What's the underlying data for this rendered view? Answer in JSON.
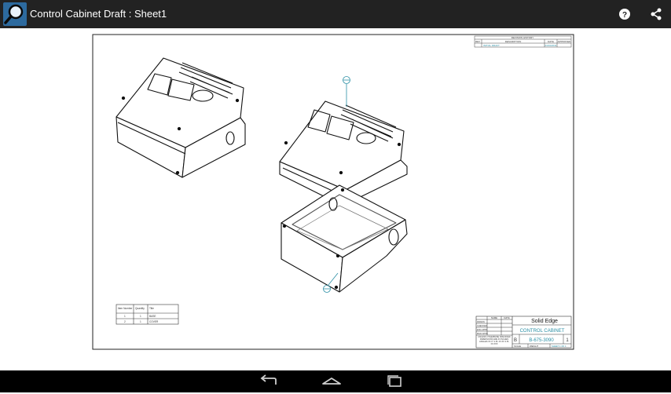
{
  "app": {
    "title": "Control Cabinet Draft : Sheet1"
  },
  "actions": {
    "help_icon": "help-circle-icon",
    "share_icon": "share-icon"
  },
  "drawing": {
    "revision_history": {
      "title": "REVISION HISTORY",
      "headers": [
        "REV",
        "DESCRIPTION",
        "DATE",
        "APPROVED"
      ],
      "rows": [
        [
          "",
          "INITIAL DRAFT",
          "01/01/2011",
          ""
        ]
      ]
    },
    "parts_list": {
      "headers": [
        "Item Number",
        "Quantity",
        "Title"
      ],
      "rows": [
        [
          "1",
          "1",
          "BASE"
        ],
        [
          "2",
          "1",
          "COVER"
        ]
      ]
    },
    "title_block": {
      "product": "Solid Edge",
      "title": "CONTROL CABINET",
      "size": "B",
      "dwg_no": "B-675-3090",
      "rev": "1",
      "scale_label": "SCALE",
      "weight_label": "WEIGHT",
      "sheet_label": "SHEET 1 OF 1",
      "name_label": "NAME",
      "date_label": "DATE",
      "drawn_label": "DRAWN",
      "checked_label": "CHECKED",
      "eng_appr_label": "ENG APPR",
      "mgr_appr_label": "MGR APPR",
      "tolerance_note": "UNLESS OTHERWISE SPECIFIED DIMENSIONS ARE IN INCHES ANGLES ±X.X° 2 PL ±X.XX 3 PL ±X.XXX"
    }
  },
  "colors": {
    "topbar": "#222222",
    "navbar": "#000000",
    "accent": "#2b8fa5"
  },
  "nav": {
    "back_icon": "back-arrow-icon",
    "home_icon": "home-icon",
    "recents_icon": "recent-apps-icon"
  }
}
